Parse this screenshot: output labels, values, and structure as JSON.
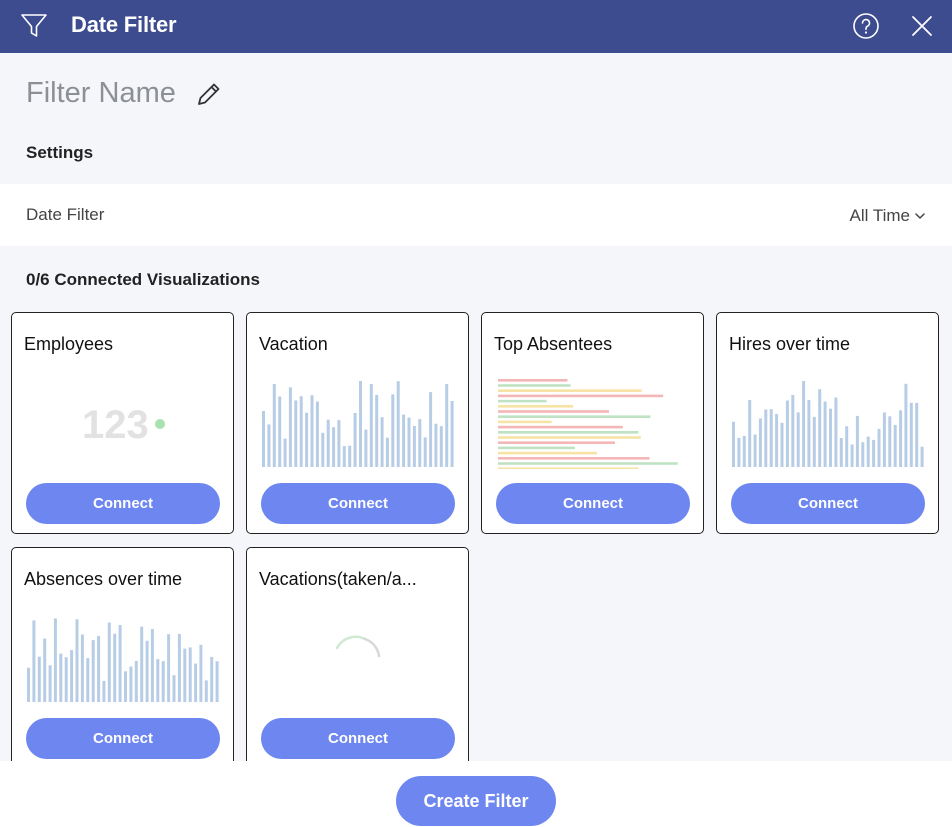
{
  "header": {
    "title": "Date Filter",
    "filter_icon": "filter-icon",
    "help_icon": "help-icon",
    "close_icon": "close-icon"
  },
  "filter_name": "Filter Name",
  "settings": {
    "label": "Settings",
    "date_filter_label": "Date Filter",
    "date_filter_value": "All Time"
  },
  "visualizations": {
    "label": "0/6 Connected Visualizations",
    "connect_label": "Connect",
    "cards": [
      {
        "title": "Employees",
        "preview": "kpi",
        "kpi_value": "123"
      },
      {
        "title": "Vacation",
        "preview": "bars"
      },
      {
        "title": "Top Absentees",
        "preview": "hbars"
      },
      {
        "title": "Hires over time",
        "preview": "bars"
      },
      {
        "title": "Absences over time",
        "preview": "bars"
      },
      {
        "title": "Vacations(taken/a...",
        "preview": "loading"
      }
    ]
  },
  "footer": {
    "create_label": "Create Filter"
  },
  "colors": {
    "header": "#3d4b8f",
    "accent": "#6e86f0",
    "bar": "#b7cde6",
    "kpi_dot": "#a8e2b0"
  }
}
